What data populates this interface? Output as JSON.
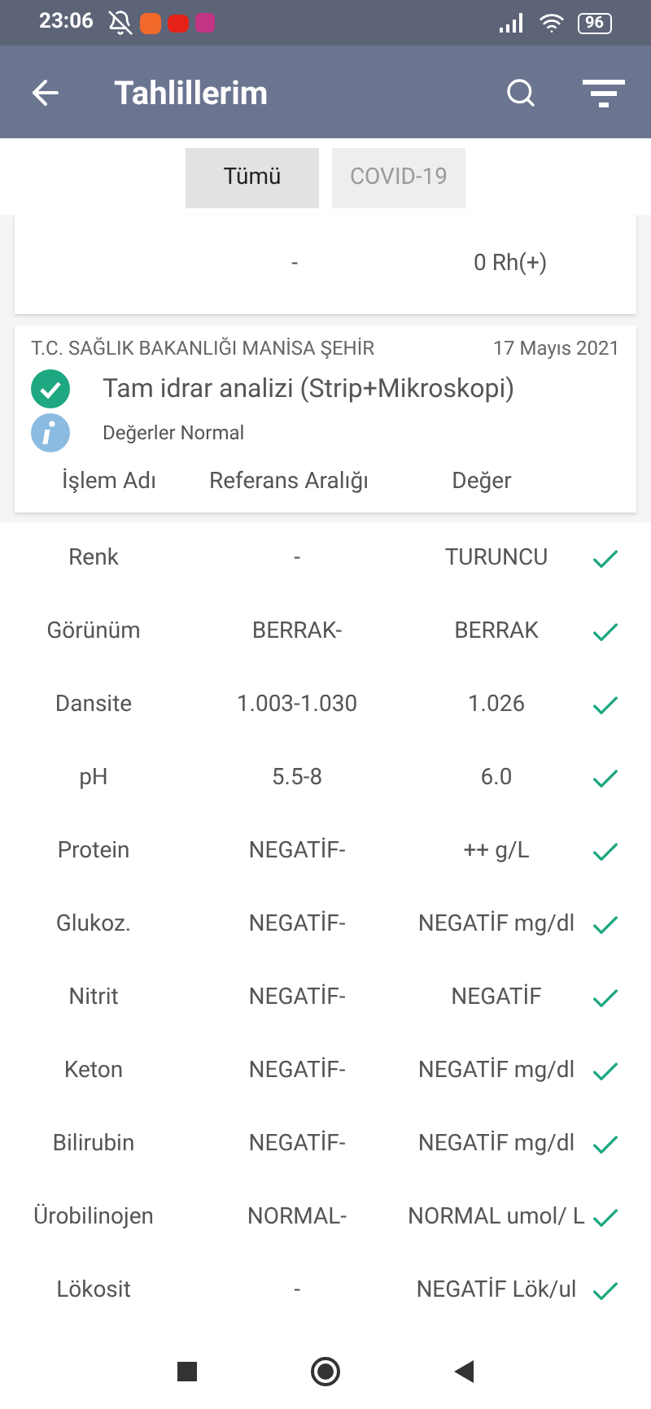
{
  "status_bar": {
    "time": "23:06",
    "battery": "96"
  },
  "app_bar": {
    "title": "Tahlillerim"
  },
  "tabs": [
    {
      "label": "Tümü",
      "selected": true
    },
    {
      "label": "COVID-19",
      "selected": false
    }
  ],
  "previous_card": {
    "reference": "-",
    "value": "0 Rh(+)"
  },
  "card": {
    "institution": "T.C. SAĞLIK BAKANLIĞI MANİSA ŞEHİR",
    "date": "17 Mayıs 2021",
    "test_name": "Tam idrar analizi (Strip+Mikroskopi)",
    "note": "Değerler Normal",
    "columns": [
      "İşlem Adı",
      "Referans Aralığı",
      "Değer"
    ]
  },
  "rows": [
    {
      "name": "Renk",
      "reference": "-",
      "value": "TURUNCU",
      "ok": true
    },
    {
      "name": "Görünüm",
      "reference": "BERRAK-",
      "value": "BERRAK",
      "ok": true
    },
    {
      "name": "Dansite",
      "reference": "1.003-1.030",
      "value": "1.026",
      "ok": true
    },
    {
      "name": "pH",
      "reference": "5.5-8",
      "value": "6.0",
      "ok": true
    },
    {
      "name": "Protein",
      "reference": "NEGATİF-",
      "value": "++ g/L",
      "ok": true
    },
    {
      "name": "Glukoz.",
      "reference": "NEGATİF-",
      "value": "NEGATİF mg/dl",
      "ok": true
    },
    {
      "name": "Nitrit",
      "reference": "NEGATİF-",
      "value": "NEGATİF",
      "ok": true
    },
    {
      "name": "Keton",
      "reference": "NEGATİF-",
      "value": "NEGATİF mg/dl",
      "ok": true
    },
    {
      "name": "Bilirubin",
      "reference": "NEGATİF-",
      "value": "NEGATİF mg/dl",
      "ok": true
    },
    {
      "name": "Ürobilinojen",
      "reference": "NORMAL-",
      "value": "NORMAL umol/ L",
      "ok": true
    },
    {
      "name": "Lökosit",
      "reference": "-",
      "value": "NEGATİF Lök/ul",
      "ok": true
    }
  ]
}
